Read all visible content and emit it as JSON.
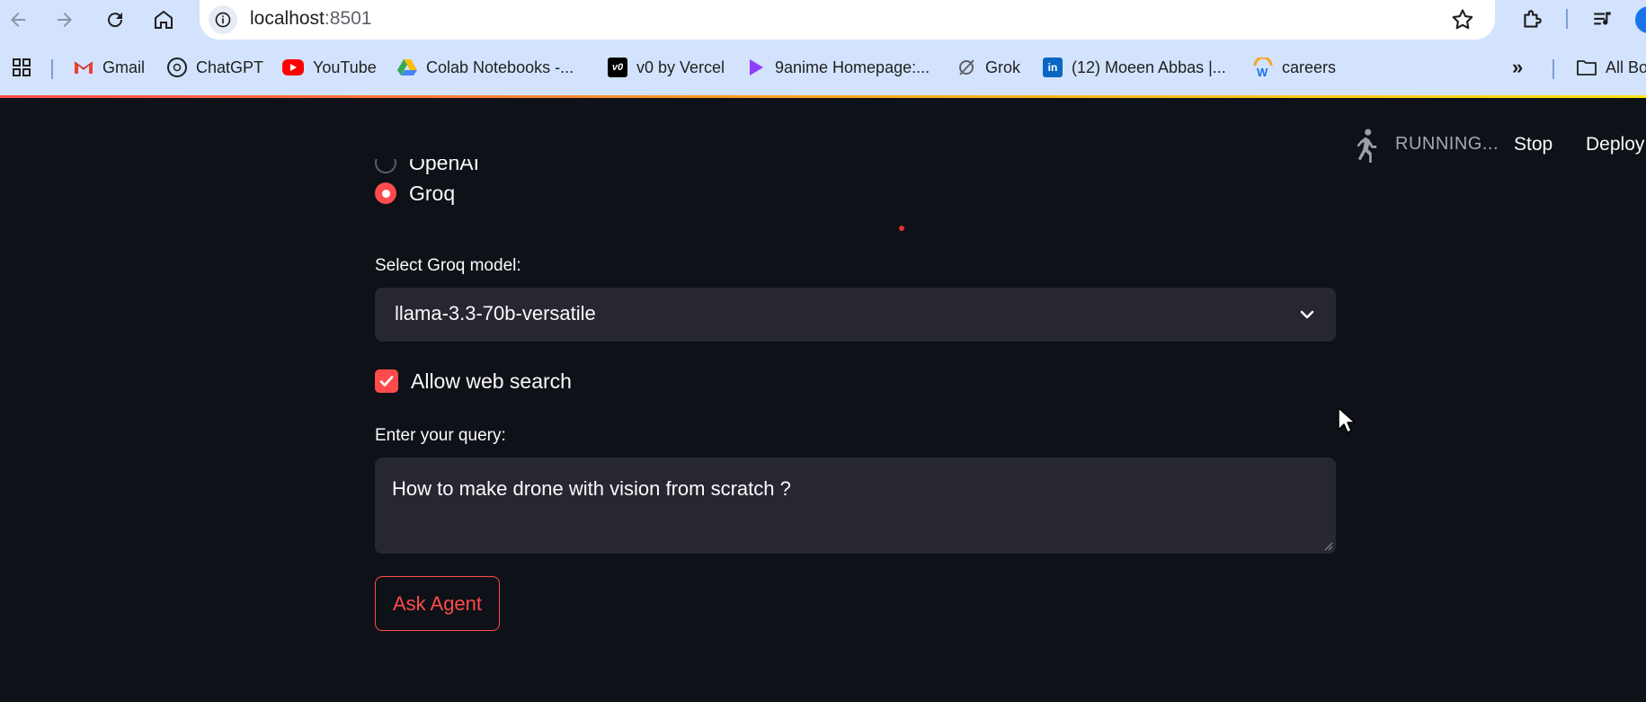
{
  "browser": {
    "url_host": "localhost",
    "url_port": ":8501",
    "bookmarks": [
      {
        "label": "Gmail",
        "icon": "gmail-icon"
      },
      {
        "label": "ChatGPT",
        "icon": "chatgpt-icon"
      },
      {
        "label": "YouTube",
        "icon": "youtube-icon"
      },
      {
        "label": "Colab Notebooks -...",
        "icon": "drive-icon"
      },
      {
        "label": "v0 by Vercel",
        "icon": "v0-icon"
      },
      {
        "label": "9anime Homepage:...",
        "icon": "play-icon"
      },
      {
        "label": "Grok",
        "icon": "grok-icon"
      },
      {
        "label": "(12) Moeen Abbas |...",
        "icon": "linkedin-icon"
      },
      {
        "label": "careers",
        "icon": "workday-icon"
      }
    ],
    "overflow_label": "»",
    "all_bookmarks_label": "All Bo"
  },
  "header": {
    "status": "RUNNING...",
    "stop_label": "Stop",
    "deploy_label": "Deploy"
  },
  "provider": {
    "options": [
      "OpenAI",
      "Groq"
    ],
    "selected": "Groq"
  },
  "model": {
    "label": "Select Groq model:",
    "value": "llama-3.3-70b-versatile"
  },
  "web_search": {
    "label": "Allow web search",
    "checked": true
  },
  "query": {
    "label": "Enter your query:",
    "value": "How to make drone with vision from scratch ?"
  },
  "ask_button": {
    "label": "Ask Agent"
  },
  "colors": {
    "accent": "#ff4b4b",
    "background": "#0e1117",
    "widget_bg": "#262730",
    "browser_chrome": "#d3e3fd"
  }
}
